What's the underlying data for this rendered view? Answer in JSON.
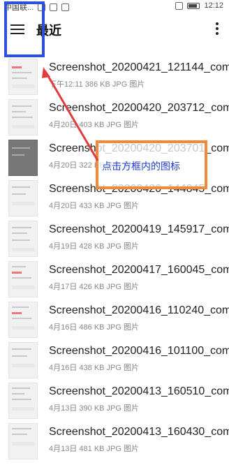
{
  "status": {
    "carrier": "中国联...",
    "time": "12:12"
  },
  "header": {
    "title": "最近"
  },
  "annotation": {
    "text": "点击方框内的图标"
  },
  "files": [
    {
      "name": "Screenshot_20200421_121144_com...",
      "meta": "下午12:11 386 KB JPG 图片"
    },
    {
      "name": "Screenshot_20200420_203712_com...",
      "meta": "4月20日 403 KB JPG 图片"
    },
    {
      "name": "Screenshot_20200420_203701_com...",
      "meta": "4月20日 322 KB JPG 图片"
    },
    {
      "name": "Screenshot_20200420_144845_com...",
      "meta": "4月20日 433 KB JPG 图片"
    },
    {
      "name": "Screenshot_20200419_145917_com...",
      "meta": "4月19日 428 KB JPG 图片"
    },
    {
      "name": "Screenshot_20200417_160045_com...",
      "meta": "4月17日 426 KB JPG 图片"
    },
    {
      "name": "Screenshot_20200416_110240_com...",
      "meta": "4月16日 486 KB JPG 图片"
    },
    {
      "name": "Screenshot_20200416_101100_com...",
      "meta": "4月16日 438 KB JPG 图片"
    },
    {
      "name": "Screenshot_20200413_160510_com...",
      "meta": "4月13日 390 KB JPG 图片"
    },
    {
      "name": "Screenshot_20200413_160430_com...",
      "meta": "4月13日 481 KB JPG 图片"
    }
  ],
  "colors": {
    "highlight_box": "#2e50d8",
    "annotation_box": "#f08a3a",
    "arrow": "#e23b3b",
    "annotation_text": "#1f3fd0"
  }
}
